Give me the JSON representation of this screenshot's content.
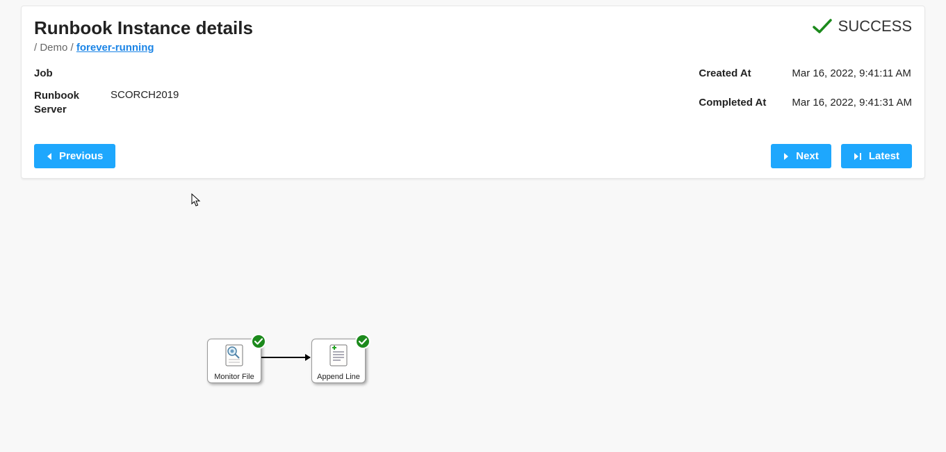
{
  "header": {
    "title": "Runbook Instance details",
    "status_label": "SUCCESS"
  },
  "breadcrumb": {
    "sep": "/",
    "folder": "Demo",
    "runbook": "forever-running"
  },
  "details": {
    "job_label": "Job",
    "job_value": "",
    "server_label": "Runbook Server",
    "server_value": "SCORCH2019",
    "created_label": "Created At",
    "created_value": "Mar 16, 2022, 9:41:11 AM",
    "completed_label": "Completed At",
    "completed_value": "Mar 16, 2022, 9:41:31 AM"
  },
  "buttons": {
    "previous": "Previous",
    "next": "Next",
    "latest": "Latest"
  },
  "workflow": {
    "nodes": [
      {
        "id": "monitor-file",
        "label": "Monitor File",
        "icon": "monitor-file-icon",
        "status": "success"
      },
      {
        "id": "append-line",
        "label": "Append Line",
        "icon": "append-line-icon",
        "status": "success"
      }
    ]
  }
}
